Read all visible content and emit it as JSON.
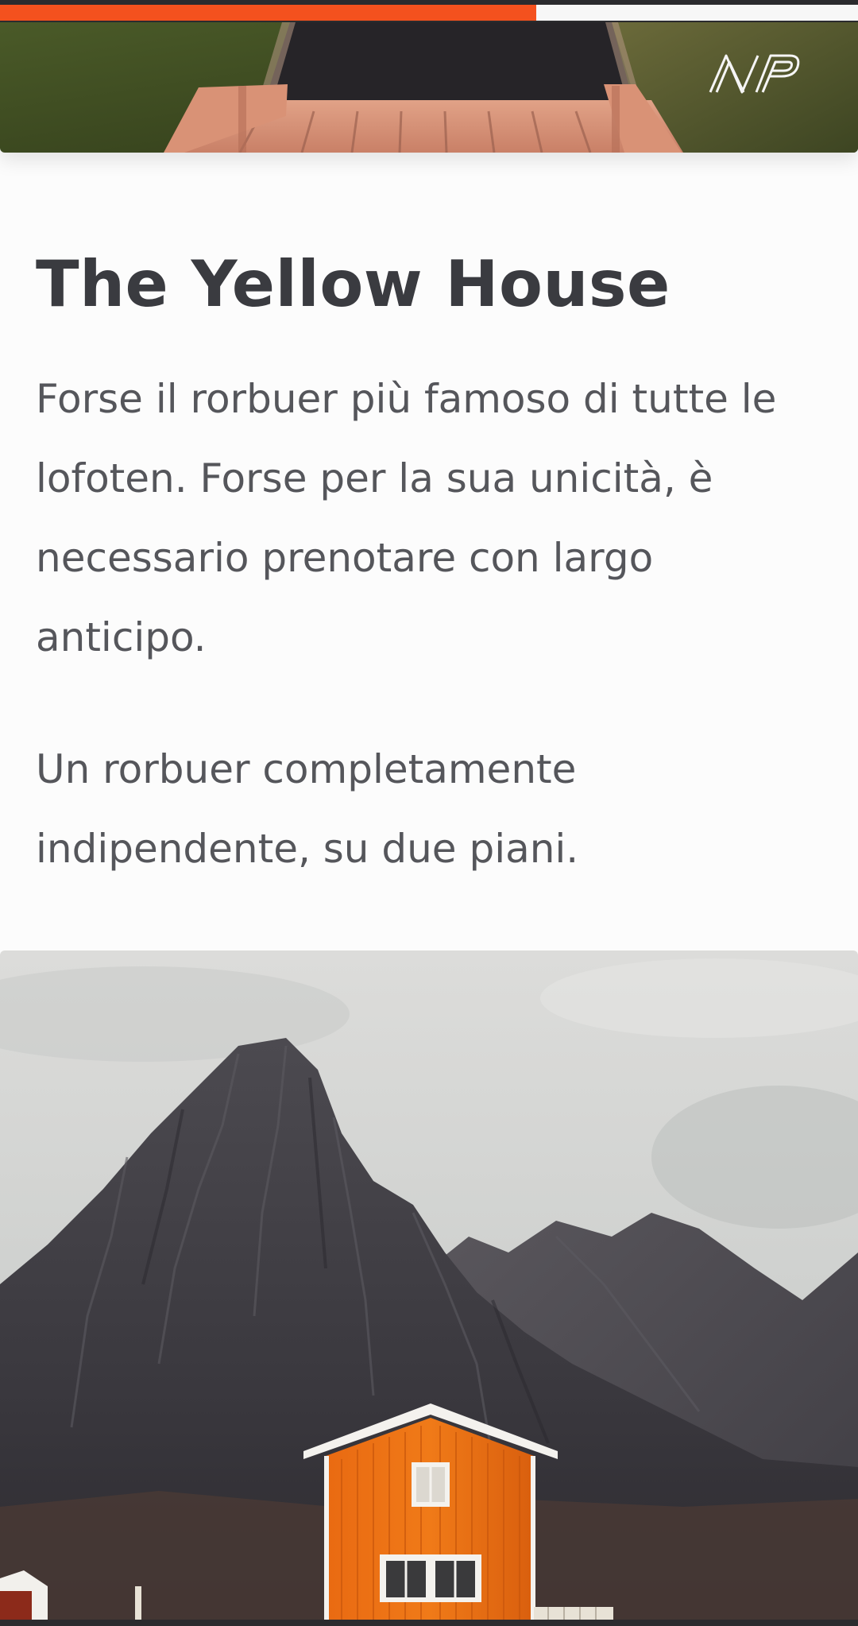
{
  "progress": {
    "fraction": 0.625,
    "color": "#f4511e"
  },
  "header": {
    "image": "pier-boardwalk-image",
    "logo": "np-logo"
  },
  "article": {
    "title": "The Yellow House",
    "paragraphs": [
      "Forse il rorbuer più famoso di tutte le lofoten. Forse per la sua unicità, è necessario prenotare con largo anticipo.",
      "Un rorbuer completamente indipendente, su due piani."
    ]
  },
  "photo": {
    "image": "mountain-red-house-image"
  },
  "colors": {
    "background": "#fcfcfc",
    "title": "#3a3b40",
    "text": "#55565b",
    "accent": "#f4511e"
  }
}
